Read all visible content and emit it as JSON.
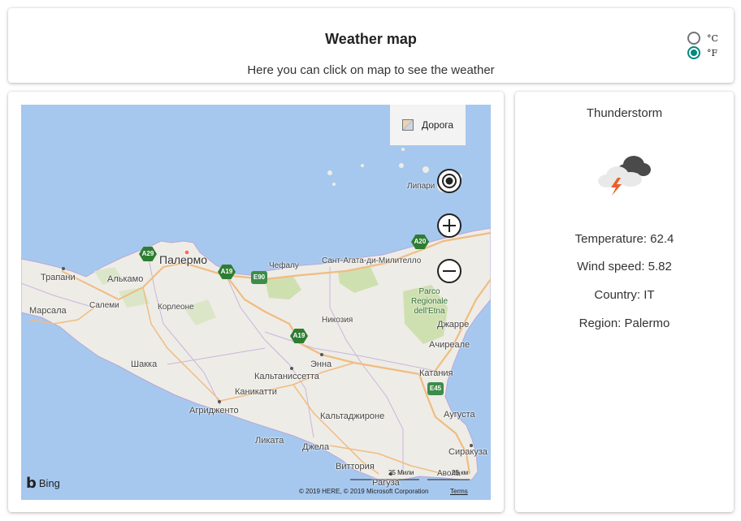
{
  "header": {
    "title": "Weather map",
    "subtitle": "Here you can click on map to see the weather",
    "units": [
      {
        "label": "°C",
        "selected": false
      },
      {
        "label": "°F",
        "selected": true
      }
    ]
  },
  "map": {
    "road_label": "Дорога",
    "bing": "Bing",
    "scale_miles": "25 Мили",
    "scale_km": "25 км",
    "copyright": "© 2019 HERE, © 2019 Microsoft Corporation",
    "terms": "Terms",
    "cities": {
      "palermo": "Палермо",
      "trapani": "Трапани",
      "alcamo": "Алькамо",
      "marsala": "Марсала",
      "salemi": "Салеми",
      "corleone": "Корлеоне",
      "cefalu": "Чефалу",
      "santagata": "Сант-Агата-ди-Милителло",
      "lipari": "Липари",
      "nicosia": "Никозия",
      "giarre": "Джарре",
      "acireale": "Ачиреале",
      "enna": "Энна",
      "caltanissetta": "Кальтаниссетта",
      "catania": "Катания",
      "sciacca": "Шакка",
      "canicatti": "Каникатти",
      "agrigento": "Агридженто",
      "caltagirone": "Кальтаджироне",
      "augusta": "Аугуста",
      "licata": "Ликата",
      "gela": "Джела",
      "siracusa": "Сиракуза",
      "vittoria": "Виттория",
      "ragusa": "Рагуза",
      "avola": "Авола"
    },
    "park": [
      "Parco",
      "Regionale",
      "dell'Etna"
    ],
    "roads": {
      "a29": "A29",
      "a19a": "A19",
      "e90": "E90",
      "a20": "A20",
      "a19b": "A19",
      "e45": "E45"
    }
  },
  "weather": {
    "condition": "Thunderstorm",
    "icon": "thunderstorm-icon",
    "temperature": "Temperature: 62.4",
    "wind": "Wind speed: 5.82",
    "country": "Country: IT",
    "region": "Region: Palermo"
  },
  "colors": {
    "accent": "#00897b",
    "sea": "#a6c8ee",
    "land": "#eeece6",
    "green": "#cfe0b0",
    "road": "#f0bc82"
  }
}
